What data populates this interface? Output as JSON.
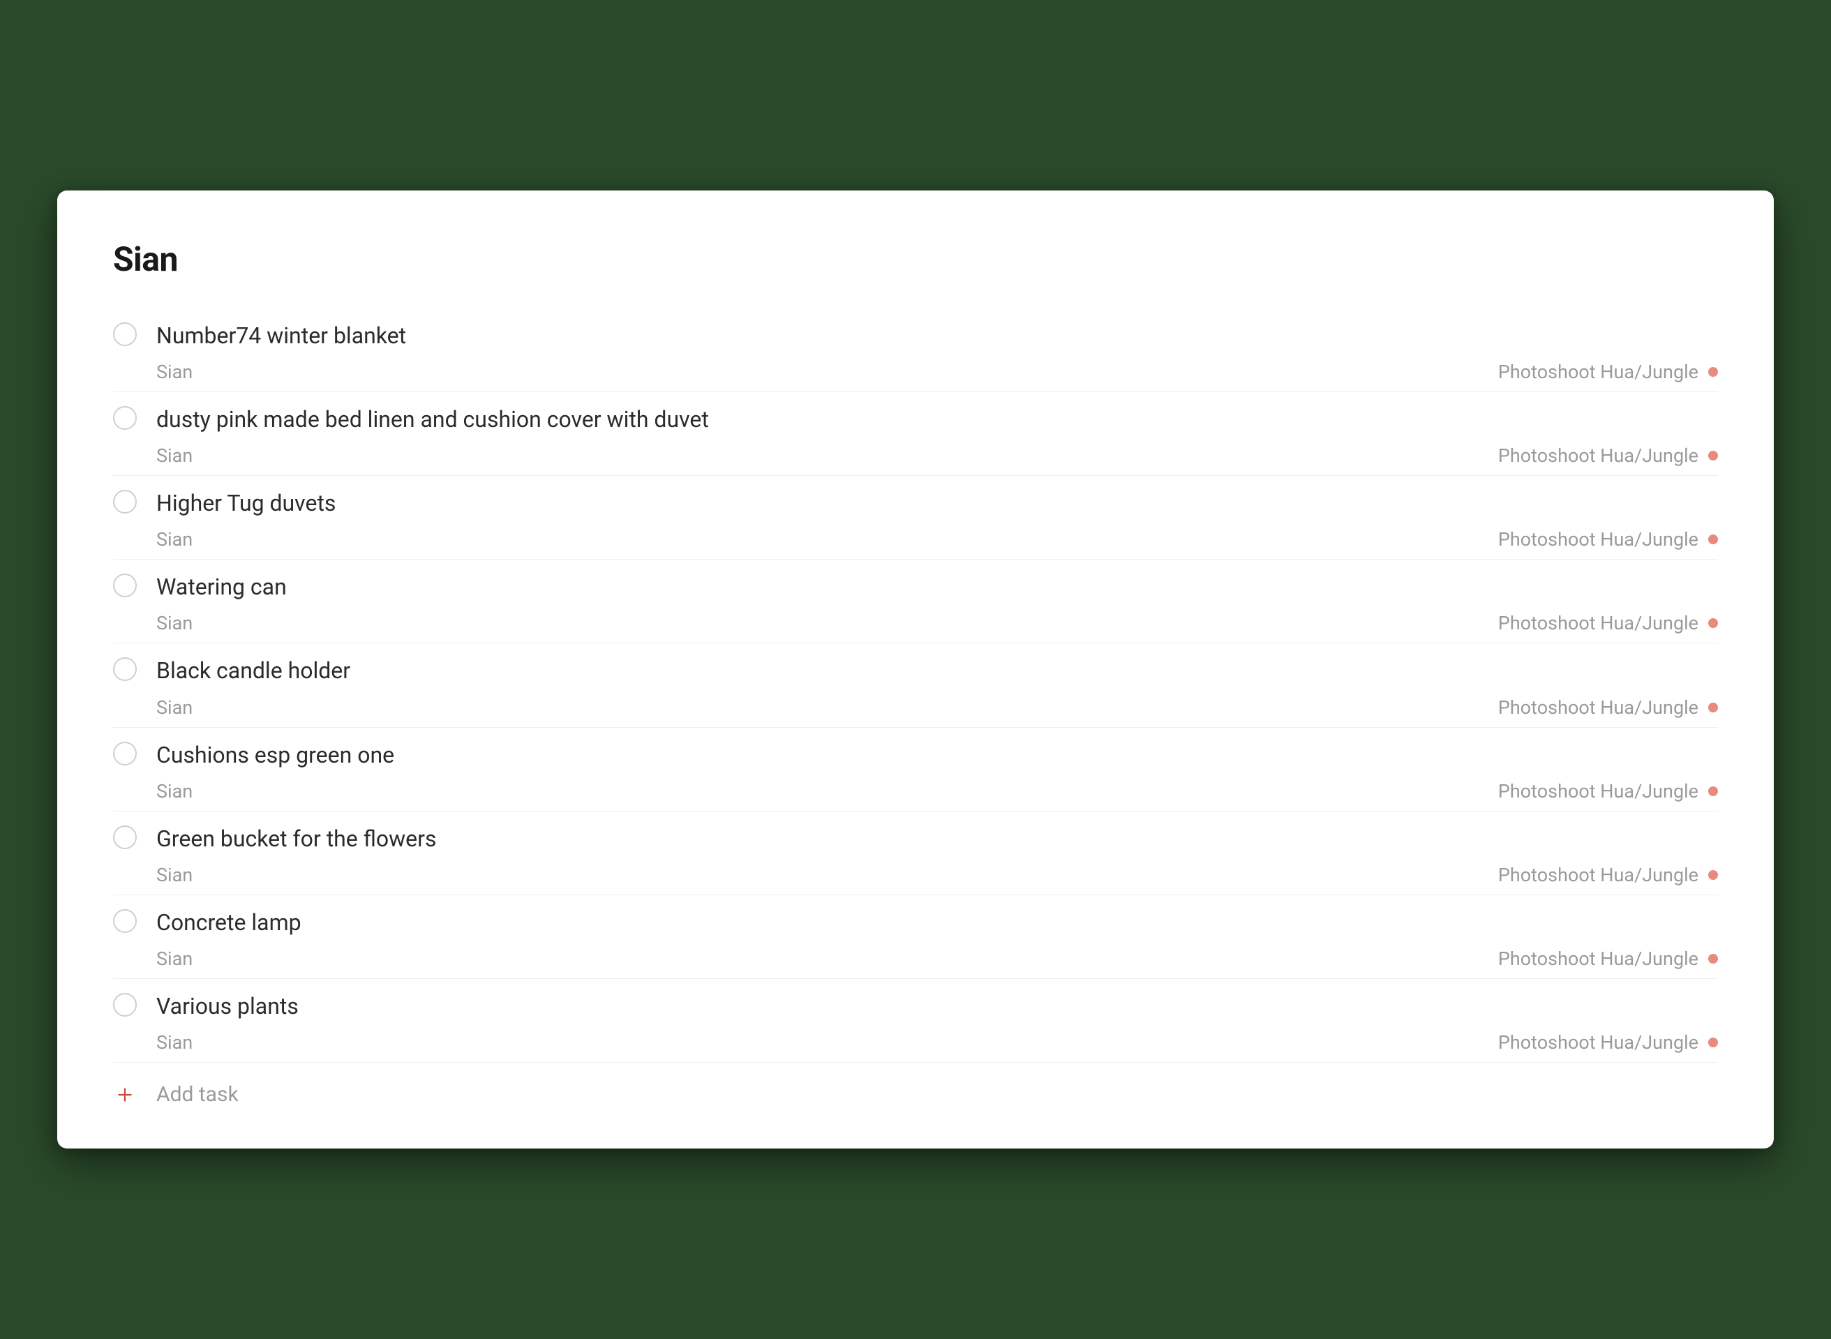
{
  "title": "Sian",
  "addTaskLabel": "Add task",
  "projectDotColor": "#e98a7f",
  "tasks": [
    {
      "title": "Number74 winter blanket",
      "label": "Sian",
      "project": "Photoshoot Hua/Jungle"
    },
    {
      "title": "dusty pink made bed linen and cushion cover with duvet",
      "label": "Sian",
      "project": "Photoshoot Hua/Jungle"
    },
    {
      "title": "Higher Tug duvets",
      "label": "Sian",
      "project": "Photoshoot Hua/Jungle"
    },
    {
      "title": "Watering can",
      "label": "Sian",
      "project": "Photoshoot Hua/Jungle"
    },
    {
      "title": "Black candle holder",
      "label": "Sian",
      "project": "Photoshoot Hua/Jungle"
    },
    {
      "title": "Cushions esp green one",
      "label": "Sian",
      "project": "Photoshoot Hua/Jungle"
    },
    {
      "title": "Green bucket for the flowers",
      "label": "Sian",
      "project": "Photoshoot Hua/Jungle"
    },
    {
      "title": "Concrete lamp",
      "label": "Sian",
      "project": "Photoshoot Hua/Jungle"
    },
    {
      "title": "Various plants",
      "label": "Sian",
      "project": "Photoshoot Hua/Jungle"
    }
  ]
}
